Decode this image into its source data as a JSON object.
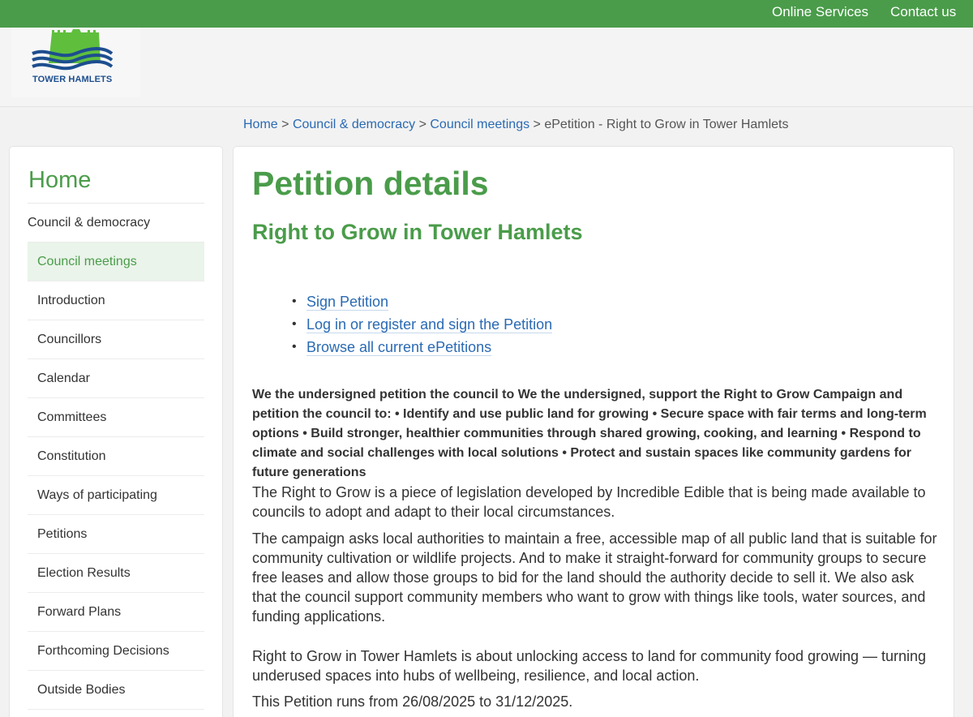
{
  "topbar": {
    "online_services": "Online Services",
    "contact_us": "Contact us"
  },
  "logo": {
    "text": "TOWER HAMLETS",
    "icon": "tower-hamlets-logo"
  },
  "breadcrumb": {
    "items": [
      "Home",
      "Council & democracy",
      "Council meetings"
    ],
    "current": "ePetition - Right to Grow in Tower Hamlets",
    "separator": ">"
  },
  "sidebar": {
    "home": "Home",
    "items": [
      {
        "label": "Council & democracy"
      },
      {
        "label": "Council meetings",
        "active": true
      },
      {
        "label": "Introduction"
      },
      {
        "label": "Councillors"
      },
      {
        "label": "Calendar"
      },
      {
        "label": "Committees"
      },
      {
        "label": "Constitution"
      },
      {
        "label": "Ways of participating"
      },
      {
        "label": "Petitions"
      },
      {
        "label": "Election Results"
      },
      {
        "label": "Forward Plans"
      },
      {
        "label": "Forthcoming Decisions"
      },
      {
        "label": "Outside Bodies"
      }
    ]
  },
  "main": {
    "title": "Petition details",
    "subtitle": "Right to Grow in Tower Hamlets",
    "actions": [
      "Sign Petition",
      "Log in or register and sign the Petition",
      "Browse all current ePetitions"
    ],
    "statement": "We the undersigned petition the council to We the undersigned, support the Right to Grow Campaign and petition the council to: • Identify and use public land for growing • Secure space with fair terms and long-term options • Build stronger, healthier communities through shared growing, cooking, and learning • Respond to climate and social challenges with local solutions • Protect and sustain spaces like community gardens for future generations",
    "paragraph1": "The Right to Grow is a piece of legislation developed by Incredible Edible that is being made available to councils to adopt and adapt to their local circumstances.",
    "paragraph2": "The campaign asks local authorities to maintain a free, accessible map of all public land that is suitable for community cultivation or wildlife projects. And to make it straight-forward for community groups to secure free leases and allow those groups to bid for the land should the authority decide to sell it. We also ask that the council support community members who want to grow with things like tools, water sources, and funding applications.",
    "paragraph3": "Right to Grow in Tower Hamlets is about unlocking access to land for community food growing — turning underused spaces into hubs of wellbeing, resilience, and local action.",
    "paragraph4": "This Petition runs from 26/08/2025 to 31/12/2025."
  },
  "colors": {
    "brand_green": "#4a9c4a",
    "link_blue": "#2a6ab3",
    "active_bg": "#eaf4ea"
  }
}
